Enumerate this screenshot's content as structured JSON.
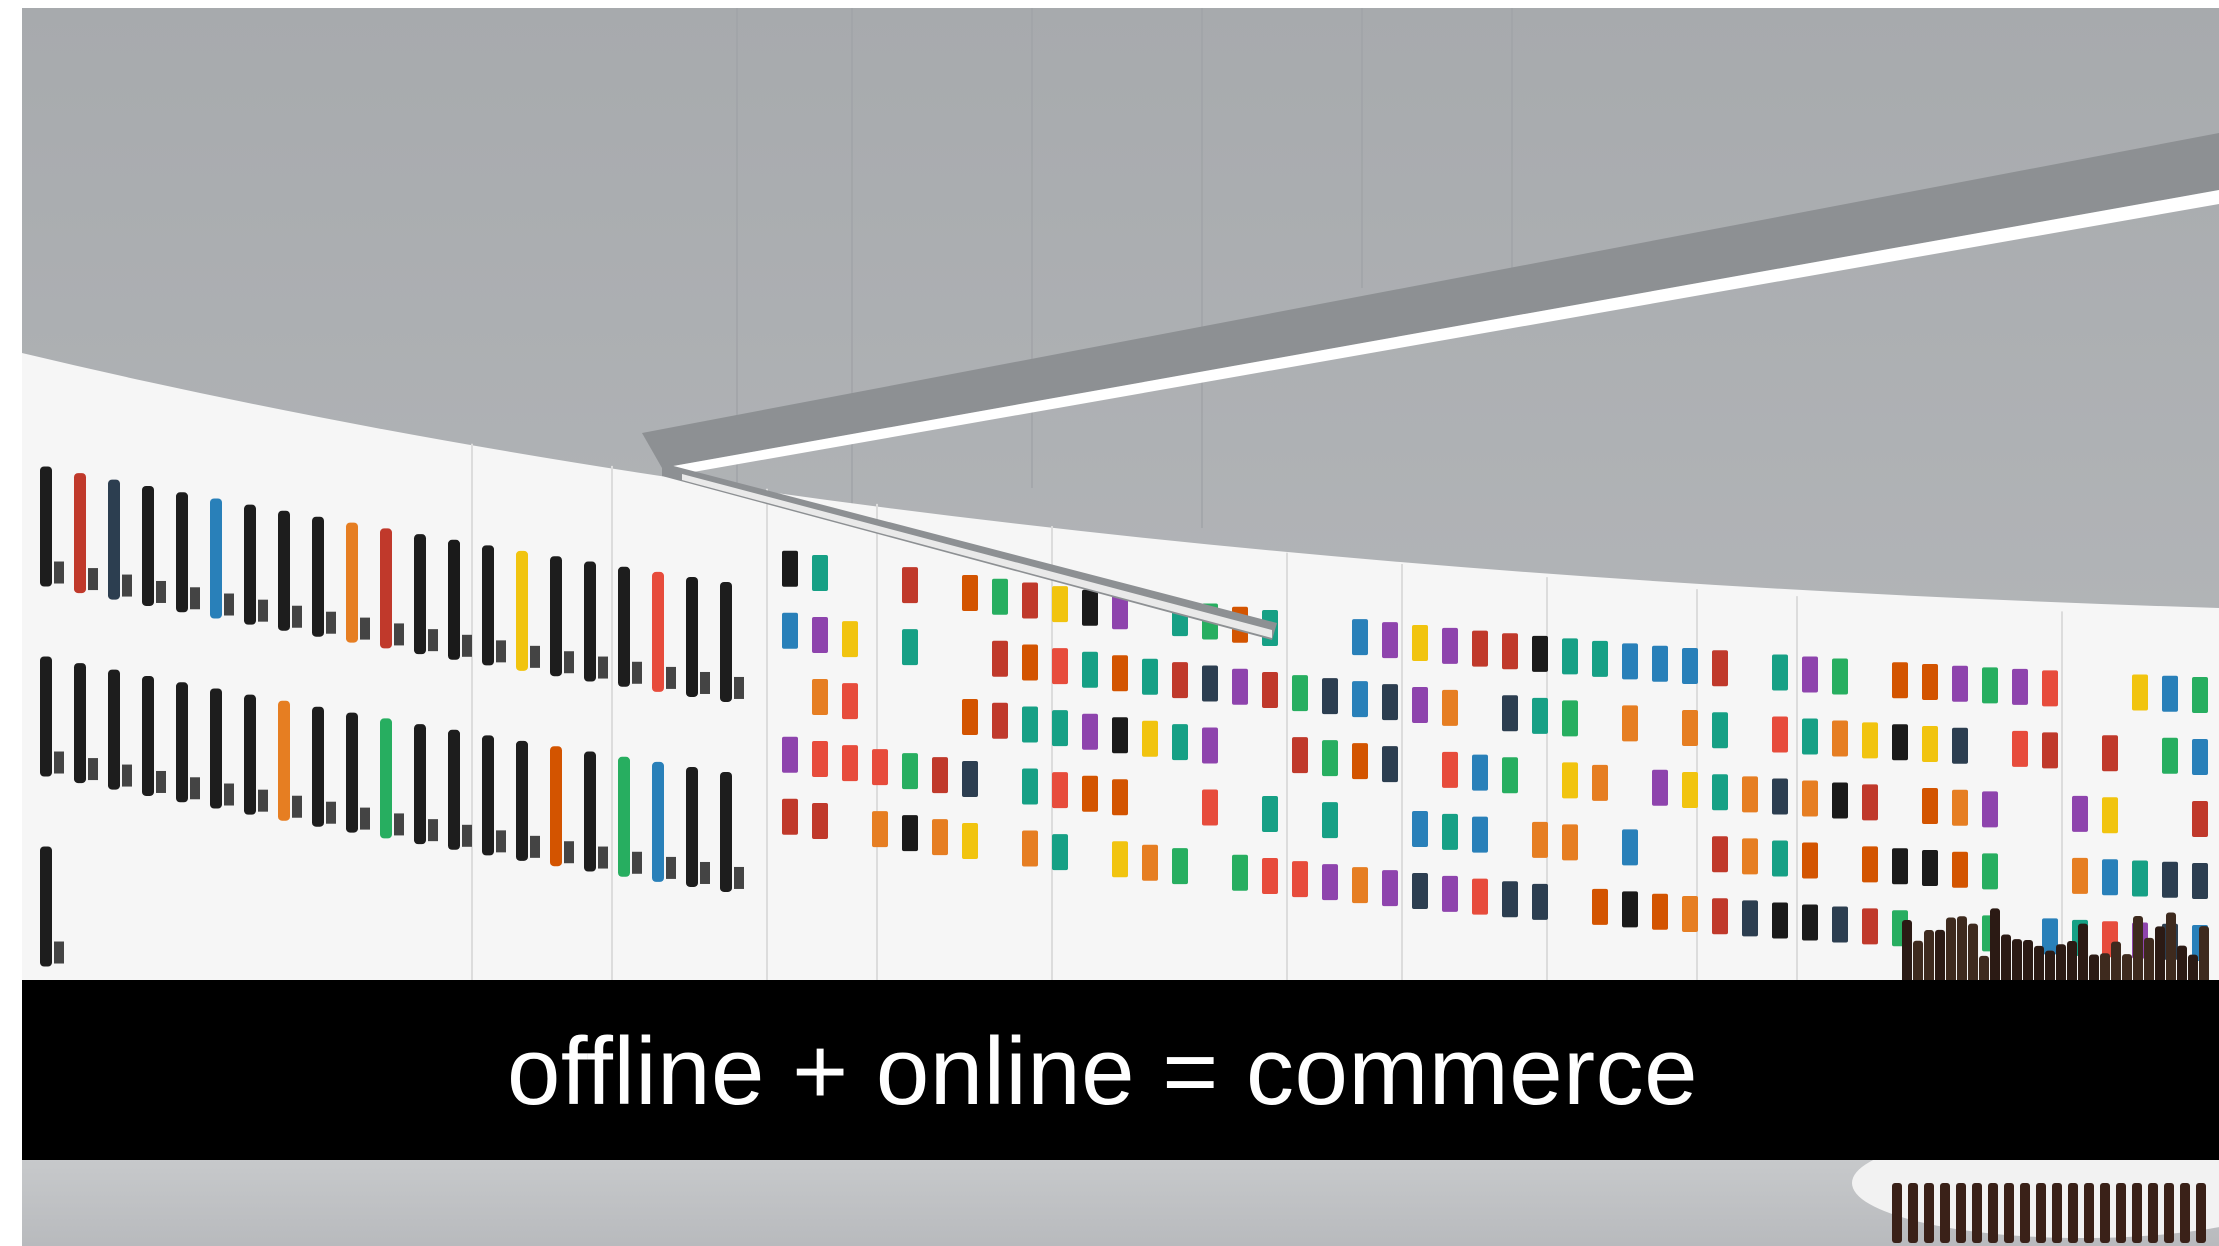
{
  "caption": {
    "text": "offline + online = commerce"
  },
  "colors": {
    "caption_bar": "#000000",
    "caption_text": "#ffffff",
    "wall_background": "#b5b8bb",
    "display_wall": "#f7f7f7",
    "light_fixture": "#8c8f92"
  }
}
